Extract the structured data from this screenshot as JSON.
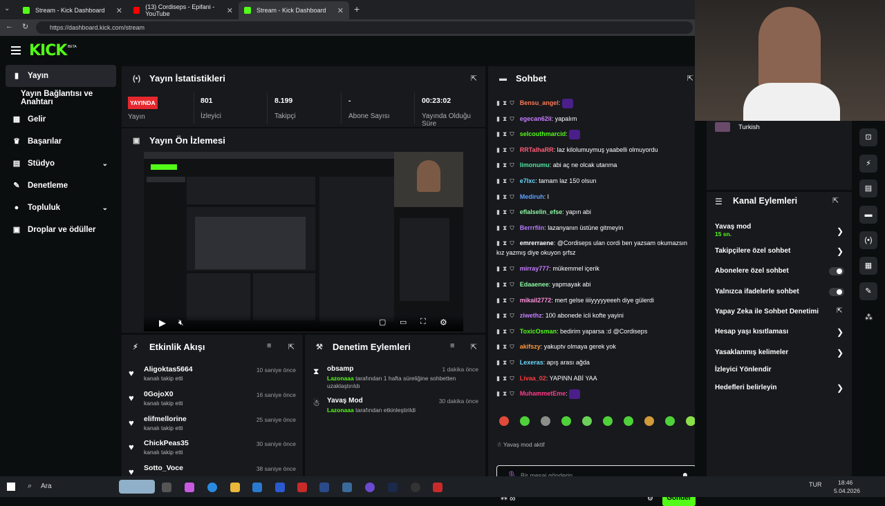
{
  "browser": {
    "tabs": [
      {
        "title": "Stream - Kick Dashboard",
        "color": "#53fc18"
      },
      {
        "title": "(13) Cordiseps - Epifani - YouTube",
        "color": "#ff0000"
      },
      {
        "title": "Stream - Kick Dashboard",
        "color": "#53fc18"
      }
    ],
    "url": "https://dashboard.kick.com/stream"
  },
  "logo": {
    "text": "KICK",
    "badge": "BETA"
  },
  "sidebar": {
    "items": [
      {
        "label": "Yayın",
        "icon": "broadcast-icon"
      },
      {
        "label": "Yayın Bağlantısı ve Anahtarı",
        "icon": ""
      },
      {
        "label": "Gelir",
        "icon": "revenue-icon"
      },
      {
        "label": "Başarılar",
        "icon": "trophy-icon"
      },
      {
        "label": "Stüdyo",
        "icon": "studio-icon"
      },
      {
        "label": "Denetleme",
        "icon": "wrench-icon"
      },
      {
        "label": "Topluluk",
        "icon": "community-icon"
      },
      {
        "label": "Droplar ve ödüller",
        "icon": "gift-icon"
      }
    ]
  },
  "stats": {
    "title": "Yayın İstatistikleri",
    "live_badge": "YAYINDA",
    "live_label": "Yayın",
    "items": [
      {
        "value": "801",
        "label": "İzleyici"
      },
      {
        "value": "8.199",
        "label": "Takipçi"
      },
      {
        "value": "-",
        "label": "Abone Sayısı"
      },
      {
        "value": "00:23:02",
        "label": "Yayında Olduğu Süre"
      }
    ]
  },
  "preview": {
    "title": "Yayın Ön İzlemesi"
  },
  "activity": {
    "title": "Etkinlik Akışı",
    "rows": [
      {
        "name": "Aligoktas5664",
        "sub": "kanalı takip etti",
        "time": "10 saniye önce"
      },
      {
        "name": "0GojoX0",
        "sub": "kanalı takip etti",
        "time": "16 saniye önce"
      },
      {
        "name": "elifmellorine",
        "sub": "kanalı takip etti",
        "time": "25 saniye önce"
      },
      {
        "name": "ChickPeas35",
        "sub": "kanalı takip etti",
        "time": "30 saniye önce"
      },
      {
        "name": "Sotto_Voce",
        "sub": "",
        "time": "38 saniye önce"
      }
    ]
  },
  "moderation": {
    "title": "Denetim Eylemleri",
    "rows": [
      {
        "name": "obsamp",
        "actor": "Lazonaaa",
        "desc": "tarafından 1 hafta süreliğine sohbetten uzaklaştırıldı",
        "time": "1 dakika önce"
      },
      {
        "name": "Yavaş Mod",
        "actor": "Lazonaaa",
        "desc": "tarafından etkinleştirildi",
        "time": "30 dakika önce"
      }
    ]
  },
  "chat": {
    "title": "Sohbet",
    "messages": [
      {
        "user": "Bensu_angel",
        "color": "#ff7a55",
        "text": "",
        "emote": true
      },
      {
        "user": "egecan62ii",
        "color": "#c77dff",
        "text": "yapalım",
        "emote": false
      },
      {
        "user": "selcouthmarcid",
        "color": "#53fc18",
        "text": "",
        "emote": true
      },
      {
        "user": "RRTalhaRR",
        "color": "#ff5f79",
        "text": "laz kilolumuymuş yaabelli olmuyordu",
        "emote": false
      },
      {
        "user": "limonumu",
        "color": "#4fe3a0",
        "text": "abi aç ne olcak utanma",
        "emote": false
      },
      {
        "user": "e7lxc",
        "color": "#6ad8ff",
        "text": "tamam laz 150 olsun",
        "emote": false
      },
      {
        "user": "Mediruh",
        "color": "#5ea0ff",
        "text": "l",
        "emote": false
      },
      {
        "user": "eflalselin_efse",
        "color": "#8cf5a0",
        "text": "yapın abi",
        "emote": false
      },
      {
        "user": "Berrrfiin",
        "color": "#b57bff",
        "text": "lazanyanın üstüne gitmeyin",
        "emote": false
      },
      {
        "user": "emrerraene",
        "color": "#ffffff",
        "text": "@Cordiseps ulan cordi ben yazsam okumazsın kız yazmış diye okuyon şrfsz",
        "emote": false
      },
      {
        "user": "mirray777",
        "color": "#c77dff",
        "text": "mükemmel içerik",
        "emote": false
      },
      {
        "user": "Edaaenee",
        "color": "#8cf5a0",
        "text": "yapmayak abi",
        "emote": false
      },
      {
        "user": "mikail2772",
        "color": "#ff8fd8",
        "text": "mert gelse iiiiyyyyyeeeh diye gülerdi",
        "emote": false
      },
      {
        "user": "ziwethz",
        "color": "#c77dff",
        "text": "100 abonede icli kofte yayini",
        "emote": false
      },
      {
        "user": "ToxicOsman",
        "color": "#53fc18",
        "text": "bedirim yaparsa :d @Cordiseps",
        "emote": false
      },
      {
        "user": "akifszy",
        "color": "#ff9a3c",
        "text": "yakuptv olmaya gerek yok",
        "emote": false
      },
      {
        "user": "Lexeras",
        "color": "#6ad8ff",
        "text": "apış arası ağda",
        "emote": false
      },
      {
        "user": "Livaa_02",
        "color": "#ff3b3b",
        "text": "YAPINN ABİ YAA",
        "emote": false
      },
      {
        "user": "MuhammetEme",
        "color": "#ff3b8a",
        "text": "",
        "emote": true
      }
    ],
    "slow_mode": "Yavaş mod aktif",
    "input_placeholder": "Bir mesaj gönderin",
    "send_label": "Gönder"
  },
  "actions": {
    "title": "Kanal Eylemleri",
    "lang_tag": "Turkish",
    "items": [
      {
        "label": "Yavaş mod",
        "sub": "15 sn.",
        "control": "arrow"
      },
      {
        "label": "Takipçilere özel sohbet",
        "sub": "",
        "control": "arrow"
      },
      {
        "label": "Abonelere özel sohbet",
        "sub": "",
        "control": "toggle"
      },
      {
        "label": "Yalnızca ifadelerle sohbet",
        "sub": "",
        "control": "toggle"
      },
      {
        "label": "Yapay Zeka ile Sohbet Denetimi",
        "sub": "",
        "control": "external"
      },
      {
        "label": "Hesap yaşı kısıtlaması",
        "sub": "",
        "control": "arrow"
      },
      {
        "label": "Yasaklanmış kelimeler",
        "sub": "",
        "control": "arrow"
      },
      {
        "label": "İzleyici Yönlendir",
        "sub": "",
        "control": "none"
      },
      {
        "label": "Hedefleri belirleyin",
        "sub": "",
        "control": "arrow"
      }
    ]
  },
  "taskbar": {
    "search": "Ara",
    "lang": "TUR",
    "time": "18:46",
    "date": "5.04.2026"
  }
}
